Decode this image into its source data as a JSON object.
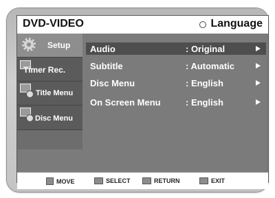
{
  "header": {
    "title": "DVD-VIDEO",
    "section": "Language"
  },
  "sidebar": {
    "items": [
      {
        "label": "Setup"
      },
      {
        "label": "Timer Rec."
      },
      {
        "label": "Title Menu"
      },
      {
        "label": "Disc Menu"
      }
    ]
  },
  "menu": {
    "rows": [
      {
        "label": "Audio",
        "value": ": Original"
      },
      {
        "label": "Subtitle",
        "value": ": Automatic"
      },
      {
        "label": "Disc Menu",
        "value": ": English"
      },
      {
        "label": "On Screen Menu",
        "value": ": English"
      }
    ]
  },
  "footer": {
    "move": "MOVE",
    "select": "SELECT",
    "return": "RETURN",
    "exit": "EXIT"
  }
}
